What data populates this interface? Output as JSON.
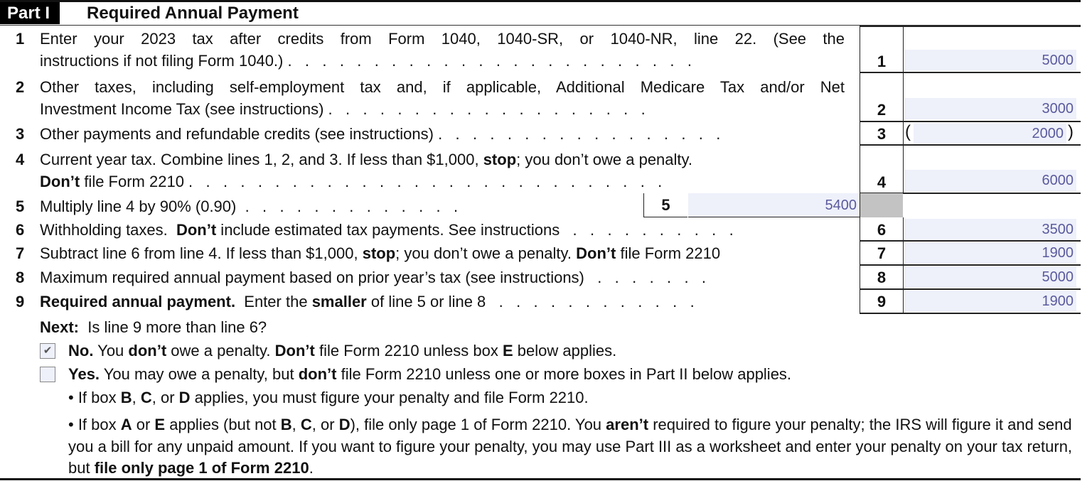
{
  "part": {
    "tag": "Part I",
    "title": "Required Annual Payment"
  },
  "lines": [
    {
      "num": "1",
      "text_line1": "Enter your 2023 tax after credits from Form 1040, 1040-SR, or 1040-NR, line 22. (See the",
      "text_line2": "instructions if not filing Form 1040.)",
      "box": "1",
      "value": "5000"
    },
    {
      "num": "2",
      "text_line1": "Other taxes, including self-employment tax and, if applicable, Additional Medicare Tax and/or Net",
      "text_line2": "Investment Income Tax (see instructions)",
      "box": "2",
      "value": "3000"
    },
    {
      "num": "3",
      "text": "Other payments and refundable credits (see instructions)",
      "box": "3",
      "value": "2000",
      "paren_open": "(",
      "paren_close": ")"
    },
    {
      "num": "4",
      "text_line1_a": "Current year tax. Combine lines 1, 2, and 3. If less than $1,000, ",
      "text_line1_b": "stop",
      "text_line1_c": "; you don’t owe a penalty.",
      "text_line2_a": "Don’t",
      "text_line2_b": " file Form 2210",
      "box": "4",
      "value": "6000"
    },
    {
      "num": "5",
      "text": "Multiply line 4 by 90% (0.90)",
      "box": "5",
      "value": "5400"
    },
    {
      "num": "6",
      "text_a": "Withholding taxes.  ",
      "text_b": "Don’t",
      "text_c": " include estimated tax payments. See instructions",
      "box": "6",
      "value": "3500"
    },
    {
      "num": "7",
      "text_a": "Subtract line 6 from line 4. If less than $1,000, ",
      "text_b": "stop",
      "text_c": "; you don’t owe a penalty. ",
      "text_d": "Don’t",
      "text_e": " file Form 2210",
      "box": "7",
      "value": "1900"
    },
    {
      "num": "8",
      "text": "Maximum required annual payment based on prior year’s tax (see instructions)",
      "box": "8",
      "value": "5000"
    },
    {
      "num": "9",
      "text_a": "Required annual payment.",
      "text_b": "  Enter the ",
      "text_c": "smaller",
      "text_d": " of line 5 or line 8",
      "box": "9",
      "value": "1900"
    }
  ],
  "next": {
    "label": "Next:",
    "question": "  Is line 9 more than line 6?"
  },
  "options": [
    {
      "checked": true,
      "check_glyph": "✔",
      "parts": [
        "No.",
        " You ",
        "don’t",
        " owe a penalty. ",
        "Don’t",
        " file Form 2210 unless box ",
        "E",
        " below applies."
      ]
    },
    {
      "checked": false,
      "check_glyph": "",
      "parts": [
        "Yes.",
        " You may owe a penalty, but ",
        "don’t",
        " file Form 2210 unless one or more boxes in Part II below applies."
      ]
    }
  ],
  "bullets": [
    {
      "parts": [
        "• If box ",
        "B",
        ", ",
        "C",
        ", or ",
        "D",
        " applies, you must figure your penalty and file Form 2210."
      ]
    },
    {
      "parts": [
        "• If box ",
        "A",
        " or ",
        "E",
        " applies (but not ",
        "B",
        ", ",
        "C",
        ", or ",
        "D",
        "), file only page 1 of Form 2210. You ",
        "aren’t",
        " required to figure your penalty; the IRS will figure it and send you a bill for any unpaid amount. If you want to figure your penalty, you may use Part III as a worksheet and enter your penalty on your tax return, but ",
        "file only page 1 of Form 2210",
        "."
      ]
    }
  ],
  "colors": {
    "field_bg": "#eef0fa",
    "field_text": "#5a5a9e",
    "shaded_cell": "#c3c3c3"
  }
}
